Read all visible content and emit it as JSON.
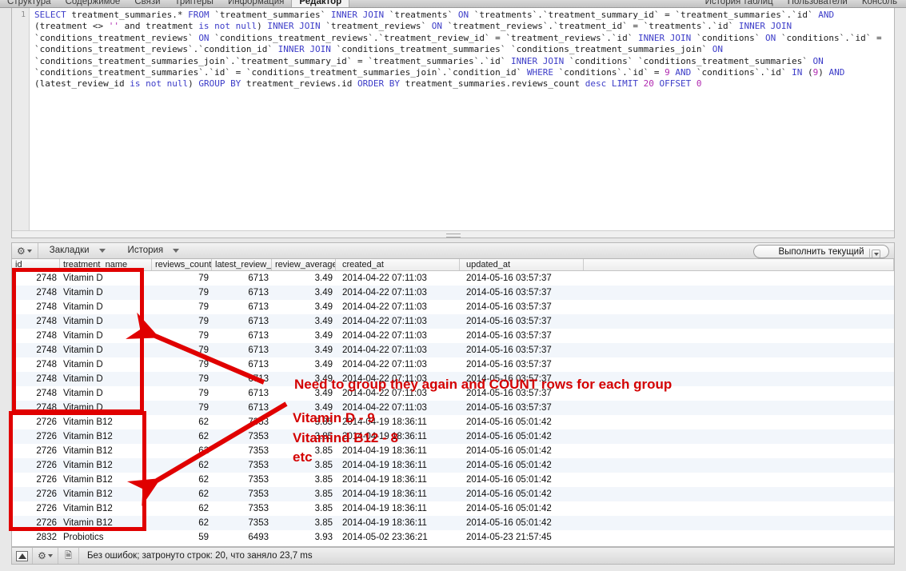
{
  "window": {
    "tabs": [
      "Структура",
      "Содержимое",
      "Связи",
      "Триггеры",
      "Информация",
      "Редактор"
    ],
    "active_tab": "Редактор",
    "right_tabs": [
      "История таблиц",
      "Пользователи",
      "Консоль"
    ]
  },
  "editor": {
    "line_number": "1",
    "query": "SELECT treatment_summaries.* FROM `treatment_summaries` INNER JOIN `treatments` ON `treatments`.`treatment_summary_id` = `treatment_summaries`.`id` AND (treatment <> '' and treatment is not null) INNER JOIN `treatment_reviews` ON `treatment_reviews`.`treatment_id` = `treatments`.`id` INNER JOIN `conditions_treatment_reviews` ON `conditions_treatment_reviews`.`treatment_review_id` = `treatment_reviews`.`id` INNER JOIN `conditions` ON `conditions`.`id` = `conditions_treatment_reviews`.`condition_id` INNER JOIN `conditions_treatment_summaries` `conditions_treatment_summaries_join` ON `conditions_treatment_summaries_join`.`treatment_summary_id` = `treatment_summaries`.`id` INNER JOIN `conditions` `conditions_treatment_summaries` ON `conditions_treatment_summaries`.`id` = `conditions_treatment_summaries_join`.`condition_id` WHERE `conditions`.`id` = 9 AND `conditions`.`id` IN (9) AND (latest_review_id is not null) GROUP BY treatment_reviews.id ORDER BY treatment_summaries.reviews_count desc LIMIT 20 OFFSET 0"
  },
  "toolbar": {
    "gear_label": "gear-icon",
    "bookmarks_label": "Закладки",
    "history_label": "История",
    "run_label": "Выполнить текущий"
  },
  "grid": {
    "columns": [
      "id",
      "treatment_name",
      "reviews_count",
      "latest_review_id",
      "review_average",
      "created_at",
      "updated_at"
    ],
    "rows": [
      {
        "id": "2748",
        "treatment_name": "Vitamin D",
        "reviews_count": "79",
        "latest_review_id": "6713",
        "review_average": "3.49",
        "created_at": "2014-04-22 07:11:03",
        "updated_at": "2014-05-16 03:57:37"
      },
      {
        "id": "2748",
        "treatment_name": "Vitamin D",
        "reviews_count": "79",
        "latest_review_id": "6713",
        "review_average": "3.49",
        "created_at": "2014-04-22 07:11:03",
        "updated_at": "2014-05-16 03:57:37"
      },
      {
        "id": "2748",
        "treatment_name": "Vitamin D",
        "reviews_count": "79",
        "latest_review_id": "6713",
        "review_average": "3.49",
        "created_at": "2014-04-22 07:11:03",
        "updated_at": "2014-05-16 03:57:37"
      },
      {
        "id": "2748",
        "treatment_name": "Vitamin D",
        "reviews_count": "79",
        "latest_review_id": "6713",
        "review_average": "3.49",
        "created_at": "2014-04-22 07:11:03",
        "updated_at": "2014-05-16 03:57:37"
      },
      {
        "id": "2748",
        "treatment_name": "Vitamin D",
        "reviews_count": "79",
        "latest_review_id": "6713",
        "review_average": "3.49",
        "created_at": "2014-04-22 07:11:03",
        "updated_at": "2014-05-16 03:57:37"
      },
      {
        "id": "2748",
        "treatment_name": "Vitamin D",
        "reviews_count": "79",
        "latest_review_id": "6713",
        "review_average": "3.49",
        "created_at": "2014-04-22 07:11:03",
        "updated_at": "2014-05-16 03:57:37"
      },
      {
        "id": "2748",
        "treatment_name": "Vitamin D",
        "reviews_count": "79",
        "latest_review_id": "6713",
        "review_average": "3.49",
        "created_at": "2014-04-22 07:11:03",
        "updated_at": "2014-05-16 03:57:37"
      },
      {
        "id": "2748",
        "treatment_name": "Vitamin D",
        "reviews_count": "79",
        "latest_review_id": "6713",
        "review_average": "3.49",
        "created_at": "2014-04-22 07:11:03",
        "updated_at": "2014-05-16 03:57:37"
      },
      {
        "id": "2748",
        "treatment_name": "Vitamin D",
        "reviews_count": "79",
        "latest_review_id": "6713",
        "review_average": "3.49",
        "created_at": "2014-04-22 07:11:03",
        "updated_at": "2014-05-16 03:57:37"
      },
      {
        "id": "2748",
        "treatment_name": "Vitamin D",
        "reviews_count": "79",
        "latest_review_id": "6713",
        "review_average": "3.49",
        "created_at": "2014-04-22 07:11:03",
        "updated_at": "2014-05-16 03:57:37"
      },
      {
        "id": "2726",
        "treatment_name": "Vitamin B12",
        "reviews_count": "62",
        "latest_review_id": "7353",
        "review_average": "3.85",
        "created_at": "2014-04-19 18:36:11",
        "updated_at": "2014-05-16 05:01:42"
      },
      {
        "id": "2726",
        "treatment_name": "Vitamin B12",
        "reviews_count": "62",
        "latest_review_id": "7353",
        "review_average": "3.85",
        "created_at": "2014-04-19 18:36:11",
        "updated_at": "2014-05-16 05:01:42"
      },
      {
        "id": "2726",
        "treatment_name": "Vitamin B12",
        "reviews_count": "62",
        "latest_review_id": "7353",
        "review_average": "3.85",
        "created_at": "2014-04-19 18:36:11",
        "updated_at": "2014-05-16 05:01:42"
      },
      {
        "id": "2726",
        "treatment_name": "Vitamin B12",
        "reviews_count": "62",
        "latest_review_id": "7353",
        "review_average": "3.85",
        "created_at": "2014-04-19 18:36:11",
        "updated_at": "2014-05-16 05:01:42"
      },
      {
        "id": "2726",
        "treatment_name": "Vitamin B12",
        "reviews_count": "62",
        "latest_review_id": "7353",
        "review_average": "3.85",
        "created_at": "2014-04-19 18:36:11",
        "updated_at": "2014-05-16 05:01:42"
      },
      {
        "id": "2726",
        "treatment_name": "Vitamin B12",
        "reviews_count": "62",
        "latest_review_id": "7353",
        "review_average": "3.85",
        "created_at": "2014-04-19 18:36:11",
        "updated_at": "2014-05-16 05:01:42"
      },
      {
        "id": "2726",
        "treatment_name": "Vitamin B12",
        "reviews_count": "62",
        "latest_review_id": "7353",
        "review_average": "3.85",
        "created_at": "2014-04-19 18:36:11",
        "updated_at": "2014-05-16 05:01:42"
      },
      {
        "id": "2726",
        "treatment_name": "Vitamin B12",
        "reviews_count": "62",
        "latest_review_id": "7353",
        "review_average": "3.85",
        "created_at": "2014-04-19 18:36:11",
        "updated_at": "2014-05-16 05:01:42"
      },
      {
        "id": "2832",
        "treatment_name": "Probiotics",
        "reviews_count": "59",
        "latest_review_id": "6493",
        "review_average": "3.93",
        "created_at": "2014-05-02 23:36:21",
        "updated_at": "2014-05-23 21:57:45"
      }
    ]
  },
  "statusbar": {
    "message": "Без ошибок; затронуто строк: 20, что заняло 23,7 ms"
  },
  "annotations": {
    "accent_color": "#d40000",
    "headline": "Need to group they again and COUNT rows for each group",
    "line_vitamin_d": "Vitamin D - 9",
    "line_vitamin_b12": "Vitamind B12 - 8",
    "line_etc": "etc"
  }
}
